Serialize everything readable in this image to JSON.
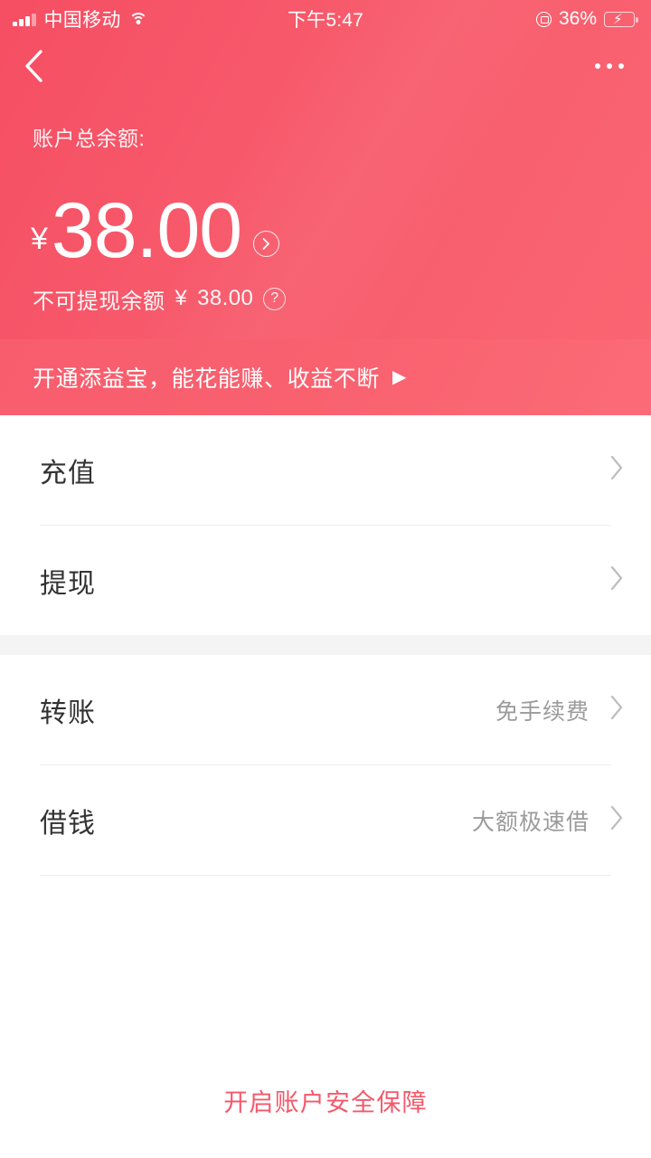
{
  "status_bar": {
    "carrier": "中国移动",
    "time": "下午5:47",
    "battery_percent": "36%",
    "signal_icon": "signal-bars-icon",
    "wifi_icon": "wifi-icon",
    "rotation_lock_icon": "rotation-lock-icon",
    "battery_icon": "battery-charging-icon"
  },
  "navbar": {
    "back_icon": "chevron-left-icon",
    "more_icon": "more-dots-icon"
  },
  "balance": {
    "label": "账户总余额:",
    "currency_symbol": "¥",
    "amount": "38.00",
    "detail_arrow_icon": "circle-chevron-right-icon",
    "sub_label": "不可提现余额",
    "sub_currency_symbol": "¥",
    "sub_amount": "38.00",
    "help_icon": "circle-question-icon",
    "help_glyph": "?"
  },
  "promo": {
    "text": "开通添益宝，能花能赚、收益不断",
    "play_icon": "play-triangle-icon",
    "play_glyph": "▶"
  },
  "groups": [
    {
      "rows": [
        {
          "title": "充值",
          "hint": "",
          "chevron_icon": "chevron-right-icon"
        },
        {
          "title": "提现",
          "hint": "",
          "chevron_icon": "chevron-right-icon"
        }
      ]
    },
    {
      "rows": [
        {
          "title": "转账",
          "hint": "免手续费",
          "chevron_icon": "chevron-right-icon"
        },
        {
          "title": "借钱",
          "hint": "大额极速借",
          "chevron_icon": "chevron-right-icon"
        }
      ]
    }
  ],
  "footer": {
    "link_text": "开启账户安全保障"
  },
  "colors": {
    "brand_red": "#f75b6c",
    "banner_red": "#f9616f",
    "footer_link": "#f4586a",
    "row_title": "#323232",
    "row_hint": "#9b9b9b",
    "divider": "#ededed",
    "group_gap": "#f4f4f5",
    "battery_green": "#3ad168"
  }
}
